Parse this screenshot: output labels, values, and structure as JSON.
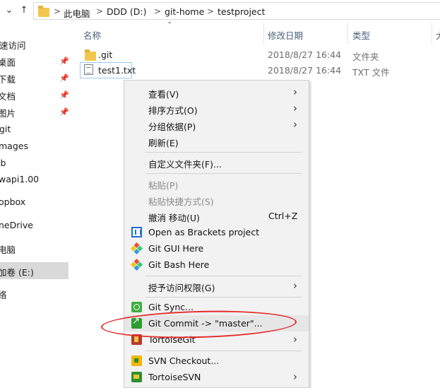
{
  "address_bar": {
    "crumbs": [
      "此电脑",
      "DDD (D:)",
      "git-home",
      "testproject"
    ],
    "separator": ">"
  },
  "sidebar": {
    "items": [
      {
        "label": "速访问",
        "pinned": false
      },
      {
        "label": "桌面",
        "pinned": true
      },
      {
        "label": "下载",
        "pinned": true
      },
      {
        "label": "文档",
        "pinned": true
      },
      {
        "label": "图片",
        "pinned": true
      },
      {
        "label": "git",
        "pinned": false
      },
      {
        "label": "mages",
        "pinned": false
      },
      {
        "label": "ib",
        "pinned": false
      },
      {
        "label": "wapi1.00",
        "pinned": false
      },
      {
        "label": "opbox",
        "pinned": false
      },
      {
        "label": "neDrive",
        "pinned": false
      },
      {
        "label": "电脑",
        "pinned": false,
        "selected": true
      },
      {
        "label": "加卷 (E:)",
        "pinned": false
      },
      {
        "label": "络",
        "pinned": false
      }
    ]
  },
  "columns": {
    "name": "名称",
    "modified": "修改日期",
    "type": "类型",
    "size": "大"
  },
  "files": [
    {
      "name": ".git",
      "modified": "2018/8/27 16:44",
      "type": "文件夹",
      "icon": "folder-icon"
    },
    {
      "name": "test1.txt",
      "modified": "2018/8/27 16:44",
      "type": "TXT 文件",
      "icon": "text-file-icon",
      "selected": true
    }
  ],
  "context_menu": {
    "view": "查看(V)",
    "sort": "排序方式(O)",
    "group": "分组依据(P)",
    "refresh": "刷新(E)",
    "customize": "自定义文件夹(F)...",
    "paste": "粘贴(P)",
    "paste_shortcut": "粘贴快捷方式(S)",
    "undo_move": "撤消 移动(U)",
    "undo_shortcut": "Ctrl+Z",
    "brackets": "Open as Brackets project",
    "git_gui": "Git GUI Here",
    "git_bash": "Git Bash Here",
    "grant_access": "授予访问权限(G)",
    "git_sync": "Git Sync...",
    "git_commit": "Git Commit -> \"master\"...",
    "tortoisegit": "TortoiseGit",
    "svn_checkout": "SVN Checkout...",
    "tortoisesvn": "TortoiseSVN"
  },
  "colors": {
    "annotation": "#e32b2b",
    "selection_border": "#99c9ef",
    "folder": "#f3c74e"
  }
}
